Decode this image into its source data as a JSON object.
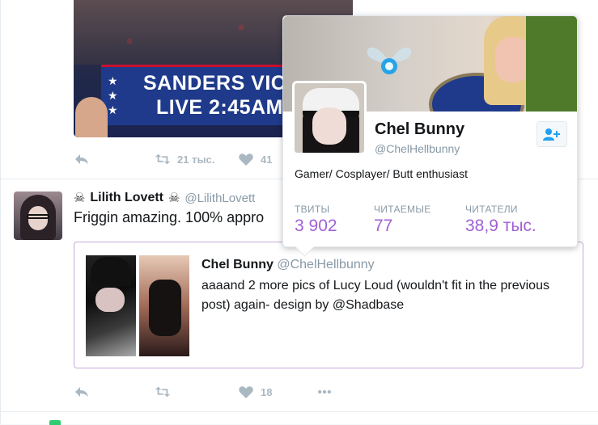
{
  "previous_tweet": {
    "media_text_line1": "SANDERS VICT",
    "media_text_line2": "LIVE 2:45AM",
    "actions": {
      "retweets": "21 тыс.",
      "likes": "41"
    }
  },
  "tweet": {
    "author_name": "Lilith Lovett",
    "author_handle": "@LilithLovett",
    "name_decoration": "☠",
    "text": "Friggin amazing. 100% appro",
    "actions": {
      "likes": "18"
    },
    "quoted": {
      "author_name": "Chel Bunny",
      "author_handle": "@ChelHellbunny",
      "text": "aaaand 2 more pics of Lucy Loud (wouldn't fit in the previous post) again- design by @Shadbase"
    }
  },
  "profile_card": {
    "name": "Chel Bunny",
    "handle": "@ChelHellbunny",
    "bio": "Gamer/ Cosplayer/ Butt enthusiast",
    "stats": [
      {
        "label": "ТВИТЫ",
        "value": "3 902"
      },
      {
        "label": "ЧИТАЕМЫЕ",
        "value": "77"
      },
      {
        "label": "ЧИТАТЕЛИ",
        "value": "38,9 тыс."
      }
    ]
  },
  "colors": {
    "accent": "#a160d4",
    "quote_border": "#c7a9d8",
    "icon_gray": "#aab8c2",
    "handle_gray": "#8899a6"
  },
  "icons": [
    "reply-icon",
    "retweet-icon",
    "like-icon",
    "more-icon",
    "follow-icon",
    "skull-icon"
  ]
}
